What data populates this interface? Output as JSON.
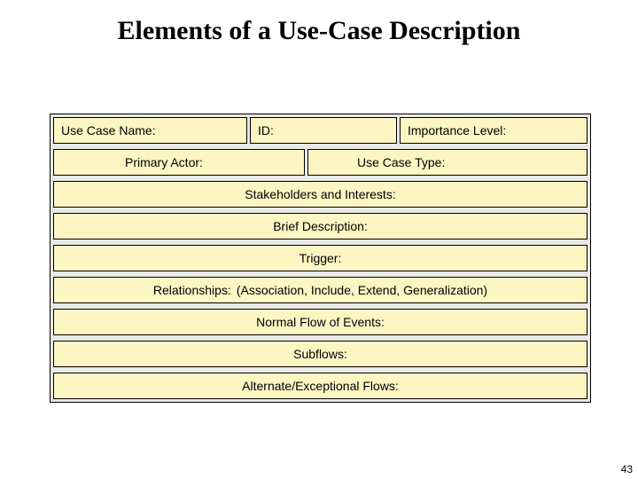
{
  "title": "Elements of a Use-Case Description",
  "pageNumber": "43",
  "rows": {
    "useCaseName": "Use Case Name:",
    "id": "ID:",
    "importanceLevel": "Importance Level:",
    "primaryActor": "Primary Actor:",
    "useCaseType": "Use Case Type:",
    "stakeholders": "Stakeholders and Interests:",
    "briefDescription": "Brief Description:",
    "trigger": "Trigger:",
    "relationshipsLabel": "Relationships:",
    "relationshipsValue": "(Association, Include, Extend, Generalization)",
    "normalFlow": "Normal Flow of Events:",
    "subflows": "Subflows:",
    "alternateFlows": "Alternate/Exceptional Flows:"
  }
}
